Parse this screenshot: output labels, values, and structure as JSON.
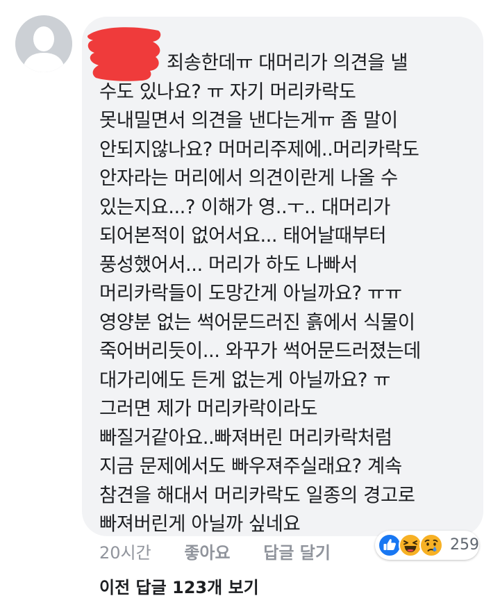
{
  "comment": {
    "lines": [
      "죄송한데ㅠ 대머리가 의견을 낼",
      "수도 있나요? ㅠ 자기 머리카락도",
      "못내밀면서 의견을 낸다는게ㅠ 좀 말이",
      "안되지않나요? 머머리주제에..머리카락도",
      "안자라는 머리에서 의견이란게 나올 수",
      "있는지요...? 이해가 영..ㅜ.. 대머리가",
      "되어본적이 없어서요... 태어날때부터",
      "풍성했어서... 머리가 하도 나빠서",
      "머리카락들이 도망간게 아닐까요? ㅠㅠ",
      "영양분 없는 썩어문드러진 흙에서 식물이",
      "죽어버리듯이... 와꾸가 썩어문드러졌는데",
      "대가리에도 든게 없는게 아닐까요? ㅠ",
      "그러면 제가 머리카락이라도",
      "빠질거같아요..빠져버린 머리카락처럼",
      "지금 문제에서도 빠우져주실래요? 계속",
      "참견을 해대서 머리카락도 일종의 경고로",
      "빠져버린게 아닐까 싶네요"
    ]
  },
  "meta": {
    "time": "20시간",
    "like_label": "좋아요",
    "reply_label": "답글 달기"
  },
  "reactions": {
    "icons": [
      "like-icon",
      "haha-icon",
      "sad-icon"
    ],
    "count": "259"
  },
  "prev_replies_label": "이전 답글 123개 보기",
  "colors": {
    "bubble": "#f2f3f5",
    "meta_text": "#90949c",
    "like_blue": "#1877f2",
    "emoji_yellow": "#f7b125",
    "redaction_red": "#ef3b3b"
  }
}
